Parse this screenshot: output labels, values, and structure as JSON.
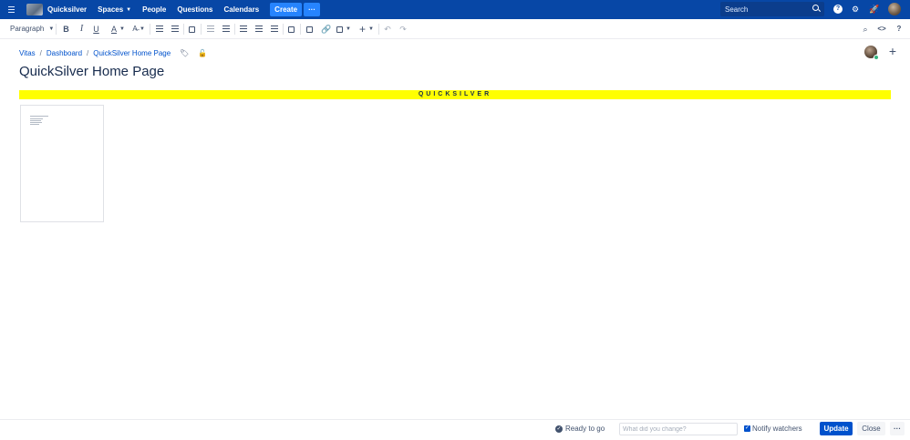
{
  "nav": {
    "app_name": "Quicksilver",
    "spaces": "Spaces",
    "people": "People",
    "questions": "Questions",
    "calendars": "Calendars",
    "create": "Create",
    "more": "···",
    "search_placeholder": "Search",
    "help_glyph": "?",
    "gear_glyph": "⚙",
    "bell_glyph": "🚀"
  },
  "toolbar": {
    "paragraph": "Paragraph",
    "bold": "B",
    "italic": "I",
    "underline": "U",
    "text_color": "A",
    "undo": "↶",
    "redo": "↷",
    "find": "⌕",
    "source": "<>",
    "help": "?"
  },
  "page": {
    "breadcrumb": [
      "Vitas",
      "Dashboard",
      "QuickSilver Home Page"
    ],
    "title": "QuickSilver Home Page",
    "banner": "QUICKSILVER"
  },
  "colors": {
    "nav_bg": "#0747a6",
    "accent": "#0052cc",
    "banner": "#ffff00"
  },
  "footer": {
    "status": "Ready to go",
    "change_placeholder": "What did you change?",
    "notify": "Notify watchers",
    "update": "Update",
    "close": "Close",
    "more": "···"
  }
}
